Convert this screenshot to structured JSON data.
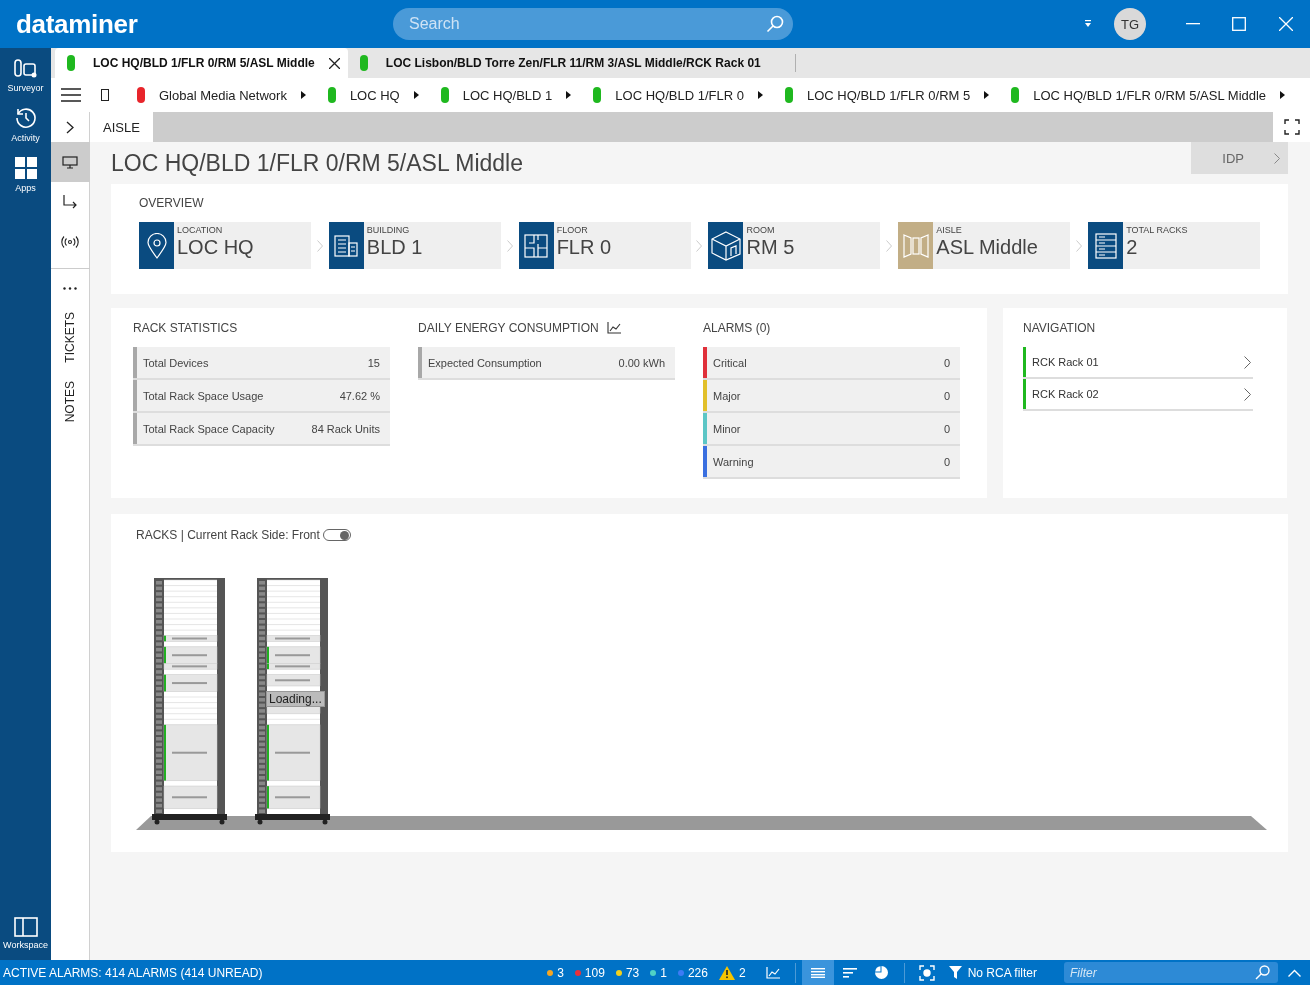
{
  "app": {
    "logo": "dataminer",
    "search": {
      "placeholder": "Search"
    },
    "user_initials": "TG"
  },
  "sidebar": {
    "items": [
      {
        "label": "Surveyor",
        "selected": false
      },
      {
        "label": "Activity",
        "selected": false
      },
      {
        "label": "Apps",
        "selected": false
      }
    ],
    "footer": "Workspace"
  },
  "tabs": [
    {
      "label": "LOC HQ/BLD 1/FLR 0/RM 5/ASL Middle",
      "color": "#1fb81f",
      "selected": true
    },
    {
      "label": "LOC Lisbon/BLD Torre Zen/FLR 11/RM 3/ASL Middle/RCK Rack 01",
      "color": "#1fb81f",
      "selected": false
    }
  ],
  "breadcrumb": [
    {
      "label": "Global Media Network",
      "color": "#e8252b"
    },
    {
      "label": "LOC HQ",
      "color": "#1fb81f"
    },
    {
      "label": "LOC HQ/BLD 1",
      "color": "#1fb81f"
    },
    {
      "label": "LOC HQ/BLD 1/FLR 0",
      "color": "#1fb81f"
    },
    {
      "label": "LOC HQ/BLD 1/FLR 0/RM 5",
      "color": "#1fb81f"
    },
    {
      "label": "LOC HQ/BLD 1/FLR 0/RM 5/ASL Middle",
      "color": "#1fb81f"
    }
  ],
  "side_tools": [
    {
      "selected": false
    },
    {
      "selected": true
    },
    {
      "selected": false
    },
    {
      "selected": false
    }
  ],
  "side_tabs": [
    "TICKETS",
    "NOTES"
  ],
  "section_tab": "AISLE",
  "title": "LOC HQ/BLD 1/FLR 0/RM 5/ASL Middle",
  "idp_button": "IDP",
  "overview": {
    "heading": "OVERVIEW",
    "items": [
      {
        "kind": "location",
        "label": "LOCATION",
        "value": "LOC HQ",
        "color": "#0a4b80"
      },
      {
        "kind": "building",
        "label": "BUILDING",
        "value": "BLD 1",
        "color": "#0a4b80"
      },
      {
        "kind": "floor",
        "label": "FLOOR",
        "value": "FLR 0",
        "color": "#0a4b80"
      },
      {
        "kind": "room",
        "label": "ROOM",
        "value": "RM 5",
        "color": "#0a4b80"
      },
      {
        "kind": "aisle",
        "label": "AISLE",
        "value": "ASL Middle",
        "color": "#c2ae86"
      },
      {
        "kind": "racks",
        "label": "TOTAL RACKS",
        "value": "2",
        "color": "#0a4b80"
      }
    ]
  },
  "rack_statistics": {
    "heading": "RACK STATISTICS",
    "rows": [
      {
        "label": "Total Devices",
        "value": "15"
      },
      {
        "label": "Total Rack Space Usage",
        "value": "47.62 %"
      },
      {
        "label": "Total Rack Space Capacity",
        "value": "84 Rack Units"
      }
    ]
  },
  "energy": {
    "heading": "DAILY ENERGY CONSUMPTION",
    "rows": [
      {
        "label": "Expected Consumption",
        "value": "0.00 kWh"
      }
    ]
  },
  "alarms": {
    "heading": "ALARMS (0)",
    "rows": [
      {
        "label": "Critical",
        "value": "0",
        "color": "#e0303a"
      },
      {
        "label": "Major",
        "value": "0",
        "color": "#e2c02a"
      },
      {
        "label": "Minor",
        "value": "0",
        "color": "#5cc6c6"
      },
      {
        "label": "Warning",
        "value": "0",
        "color": "#3a6fe0"
      }
    ]
  },
  "navigation": {
    "heading": "NAVIGATION",
    "items": [
      {
        "label": "RCK Rack 01",
        "color": "#1fb81f"
      },
      {
        "label": "RCK Rack 02",
        "color": "#1fb81f"
      }
    ]
  },
  "racks": {
    "heading": "RACKS | Current Rack Side: Front",
    "toggle": {
      "on": true
    },
    "items": [
      {
        "kind": "picture"
      },
      {
        "kind": "picture",
        "status": "Loading..."
      }
    ]
  },
  "status_bar": {
    "summary": "ACTIVE ALARMS: 414 ALARMS (414 UNREAD)",
    "counts": [
      {
        "value": "3",
        "color": "#f5a623"
      },
      {
        "value": "109",
        "color": "#e8303a"
      },
      {
        "value": "73",
        "color": "#f2d11c"
      },
      {
        "value": "1",
        "color": "#4fd1c5"
      },
      {
        "value": "226",
        "color": "#3d7bf5"
      }
    ],
    "warnings": "2",
    "view_modes": [
      {
        "selected": true
      },
      {
        "selected": false
      },
      {
        "selected": false
      }
    ],
    "rca_filter": "No RCA filter",
    "filter": {
      "placeholder": "Filter"
    }
  }
}
